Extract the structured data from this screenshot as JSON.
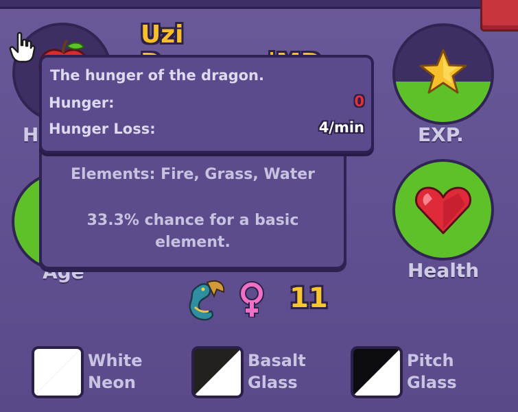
{
  "dragon": {
    "name": "Uzi Doorman|MD",
    "level": "11"
  },
  "stats": {
    "hunger": {
      "label_visible": "H",
      "fill": 0.0
    },
    "exp": {
      "label": "EXP.",
      "fill": 0.42
    },
    "age": {
      "label": "Age",
      "fill": 1.0
    },
    "health": {
      "label": "Health",
      "fill": 1.0
    }
  },
  "tooltip": {
    "description": "The hunger of the dragon.",
    "hunger_label": "Hunger:",
    "hunger_value": "0",
    "hunger_loss_label": "Hunger Loss:",
    "hunger_loss_value": "4/min"
  },
  "info_panel": {
    "elements": "Elements: Fire, Grass, Water",
    "chance": "33.3% chance for a basic element."
  },
  "colors": {
    "background": "#5d4d8c",
    "accent_gold": "#f8bf2a",
    "fill_green": "#5ec12a",
    "hunger_value_red": "#e0323a"
  },
  "icons": [
    "apple-icon",
    "star-icon",
    "heart-icon",
    "dragon-icon",
    "female-icon",
    "pointer-cursor-icon"
  ],
  "swatches": [
    {
      "line1": "White",
      "line2": "Neon",
      "colors": [
        "#ffffff",
        "#ffffff"
      ]
    },
    {
      "line1": "Basalt",
      "line2": "Glass",
      "colors": [
        "#23211d",
        "#ffffff"
      ]
    },
    {
      "line1": "Pitch",
      "line2": "Glass",
      "colors": [
        "#0c0c10",
        "#ffffff"
      ]
    }
  ]
}
